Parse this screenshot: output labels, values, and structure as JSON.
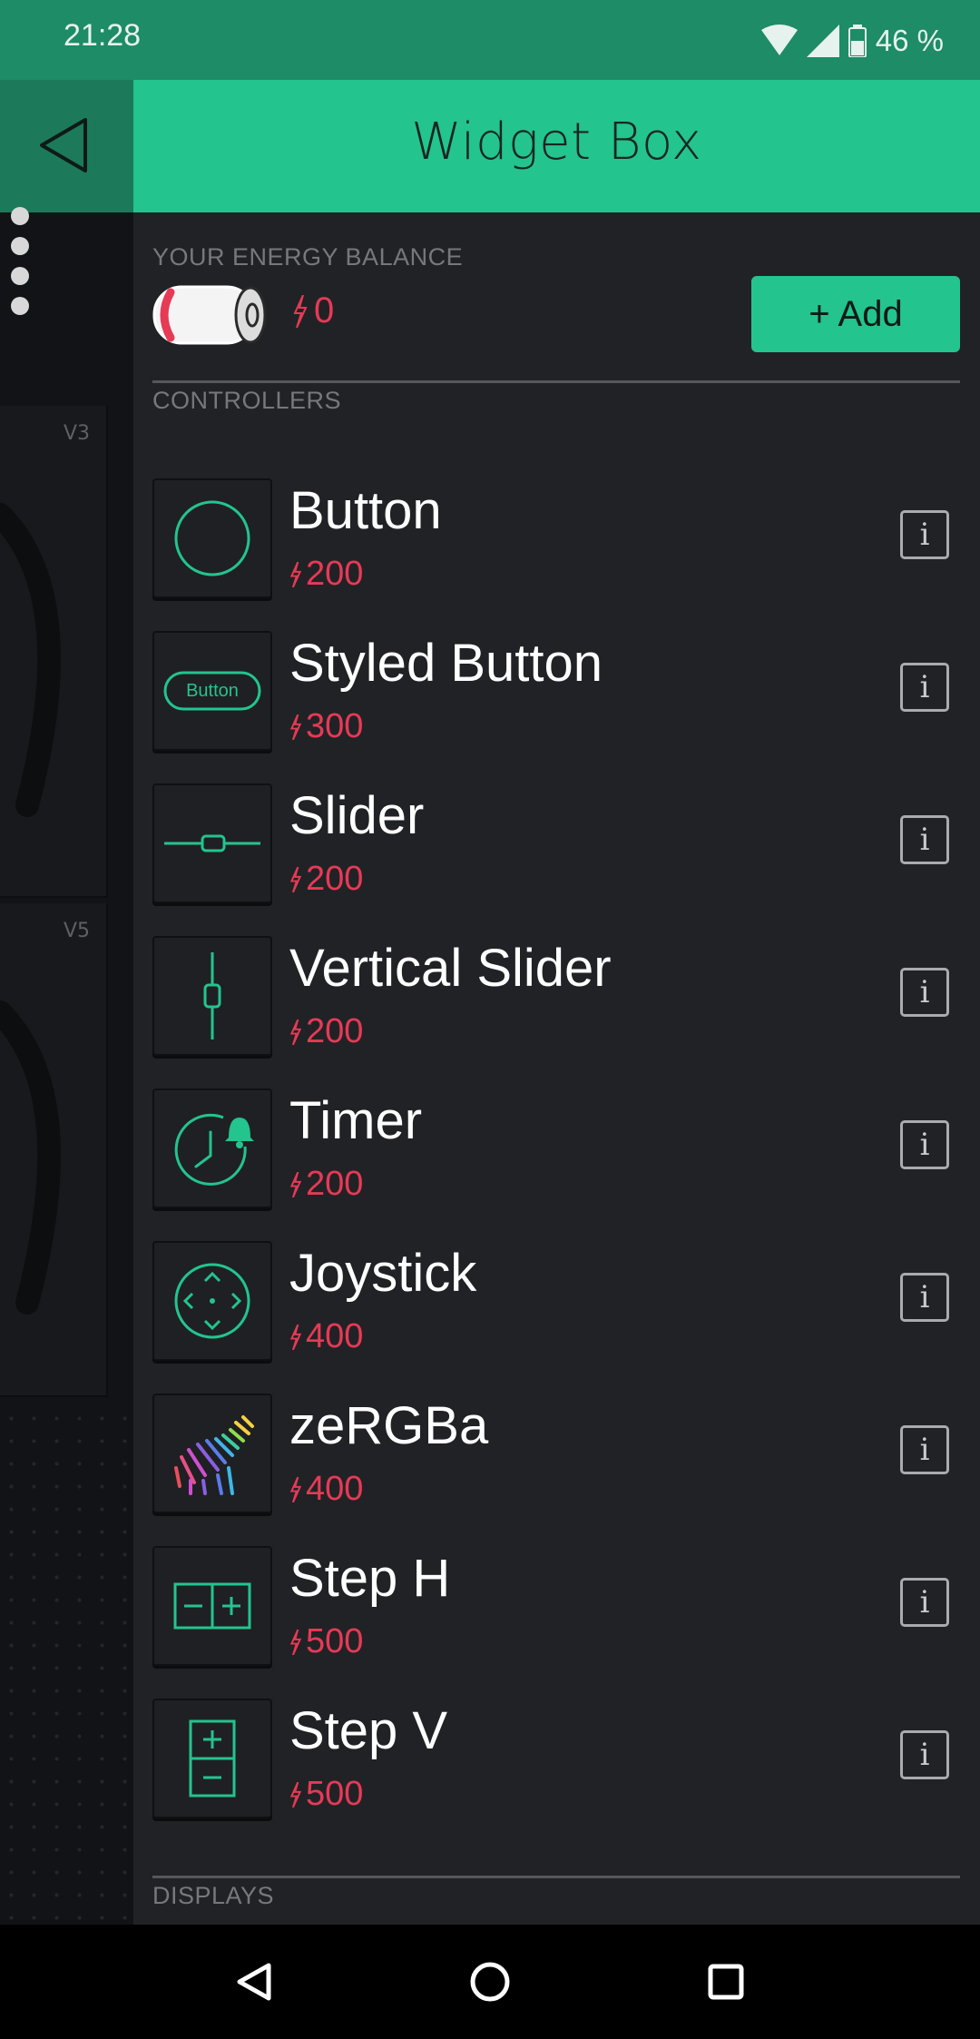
{
  "status_bar": {
    "time": "21:28",
    "battery_percent": "46 %"
  },
  "background_dashboard": {
    "widgets": [
      {
        "pin": "V3"
      },
      {
        "pin": "V5"
      }
    ]
  },
  "drawer": {
    "title": "Widget Box",
    "energy_label": "YOUR ENERGY BALANCE",
    "energy_value": "0",
    "add_button": "+ Add",
    "controllers_label": "CONTROLLERS",
    "displays_label": "DISPLAYS",
    "info_glyph": "i",
    "items": [
      {
        "name": "Button",
        "cost": "200",
        "icon": "button-circle-icon"
      },
      {
        "name": "Styled Button",
        "cost": "300",
        "icon": "styled-button-icon",
        "icon_text": "Button"
      },
      {
        "name": "Slider",
        "cost": "200",
        "icon": "slider-icon"
      },
      {
        "name": "Vertical Slider",
        "cost": "200",
        "icon": "vertical-slider-icon"
      },
      {
        "name": "Timer",
        "cost": "200",
        "icon": "timer-icon"
      },
      {
        "name": "Joystick",
        "cost": "400",
        "icon": "joystick-icon"
      },
      {
        "name": "zeRGBa",
        "cost": "400",
        "icon": "zebra-icon"
      },
      {
        "name": "Step H",
        "cost": "500",
        "icon": "step-h-icon"
      },
      {
        "name": "Step V",
        "cost": "500",
        "icon": "step-v-icon"
      }
    ]
  },
  "colors": {
    "accent": "#23c48e",
    "energy": "#e63a55",
    "drawer_bg": "#212226"
  }
}
